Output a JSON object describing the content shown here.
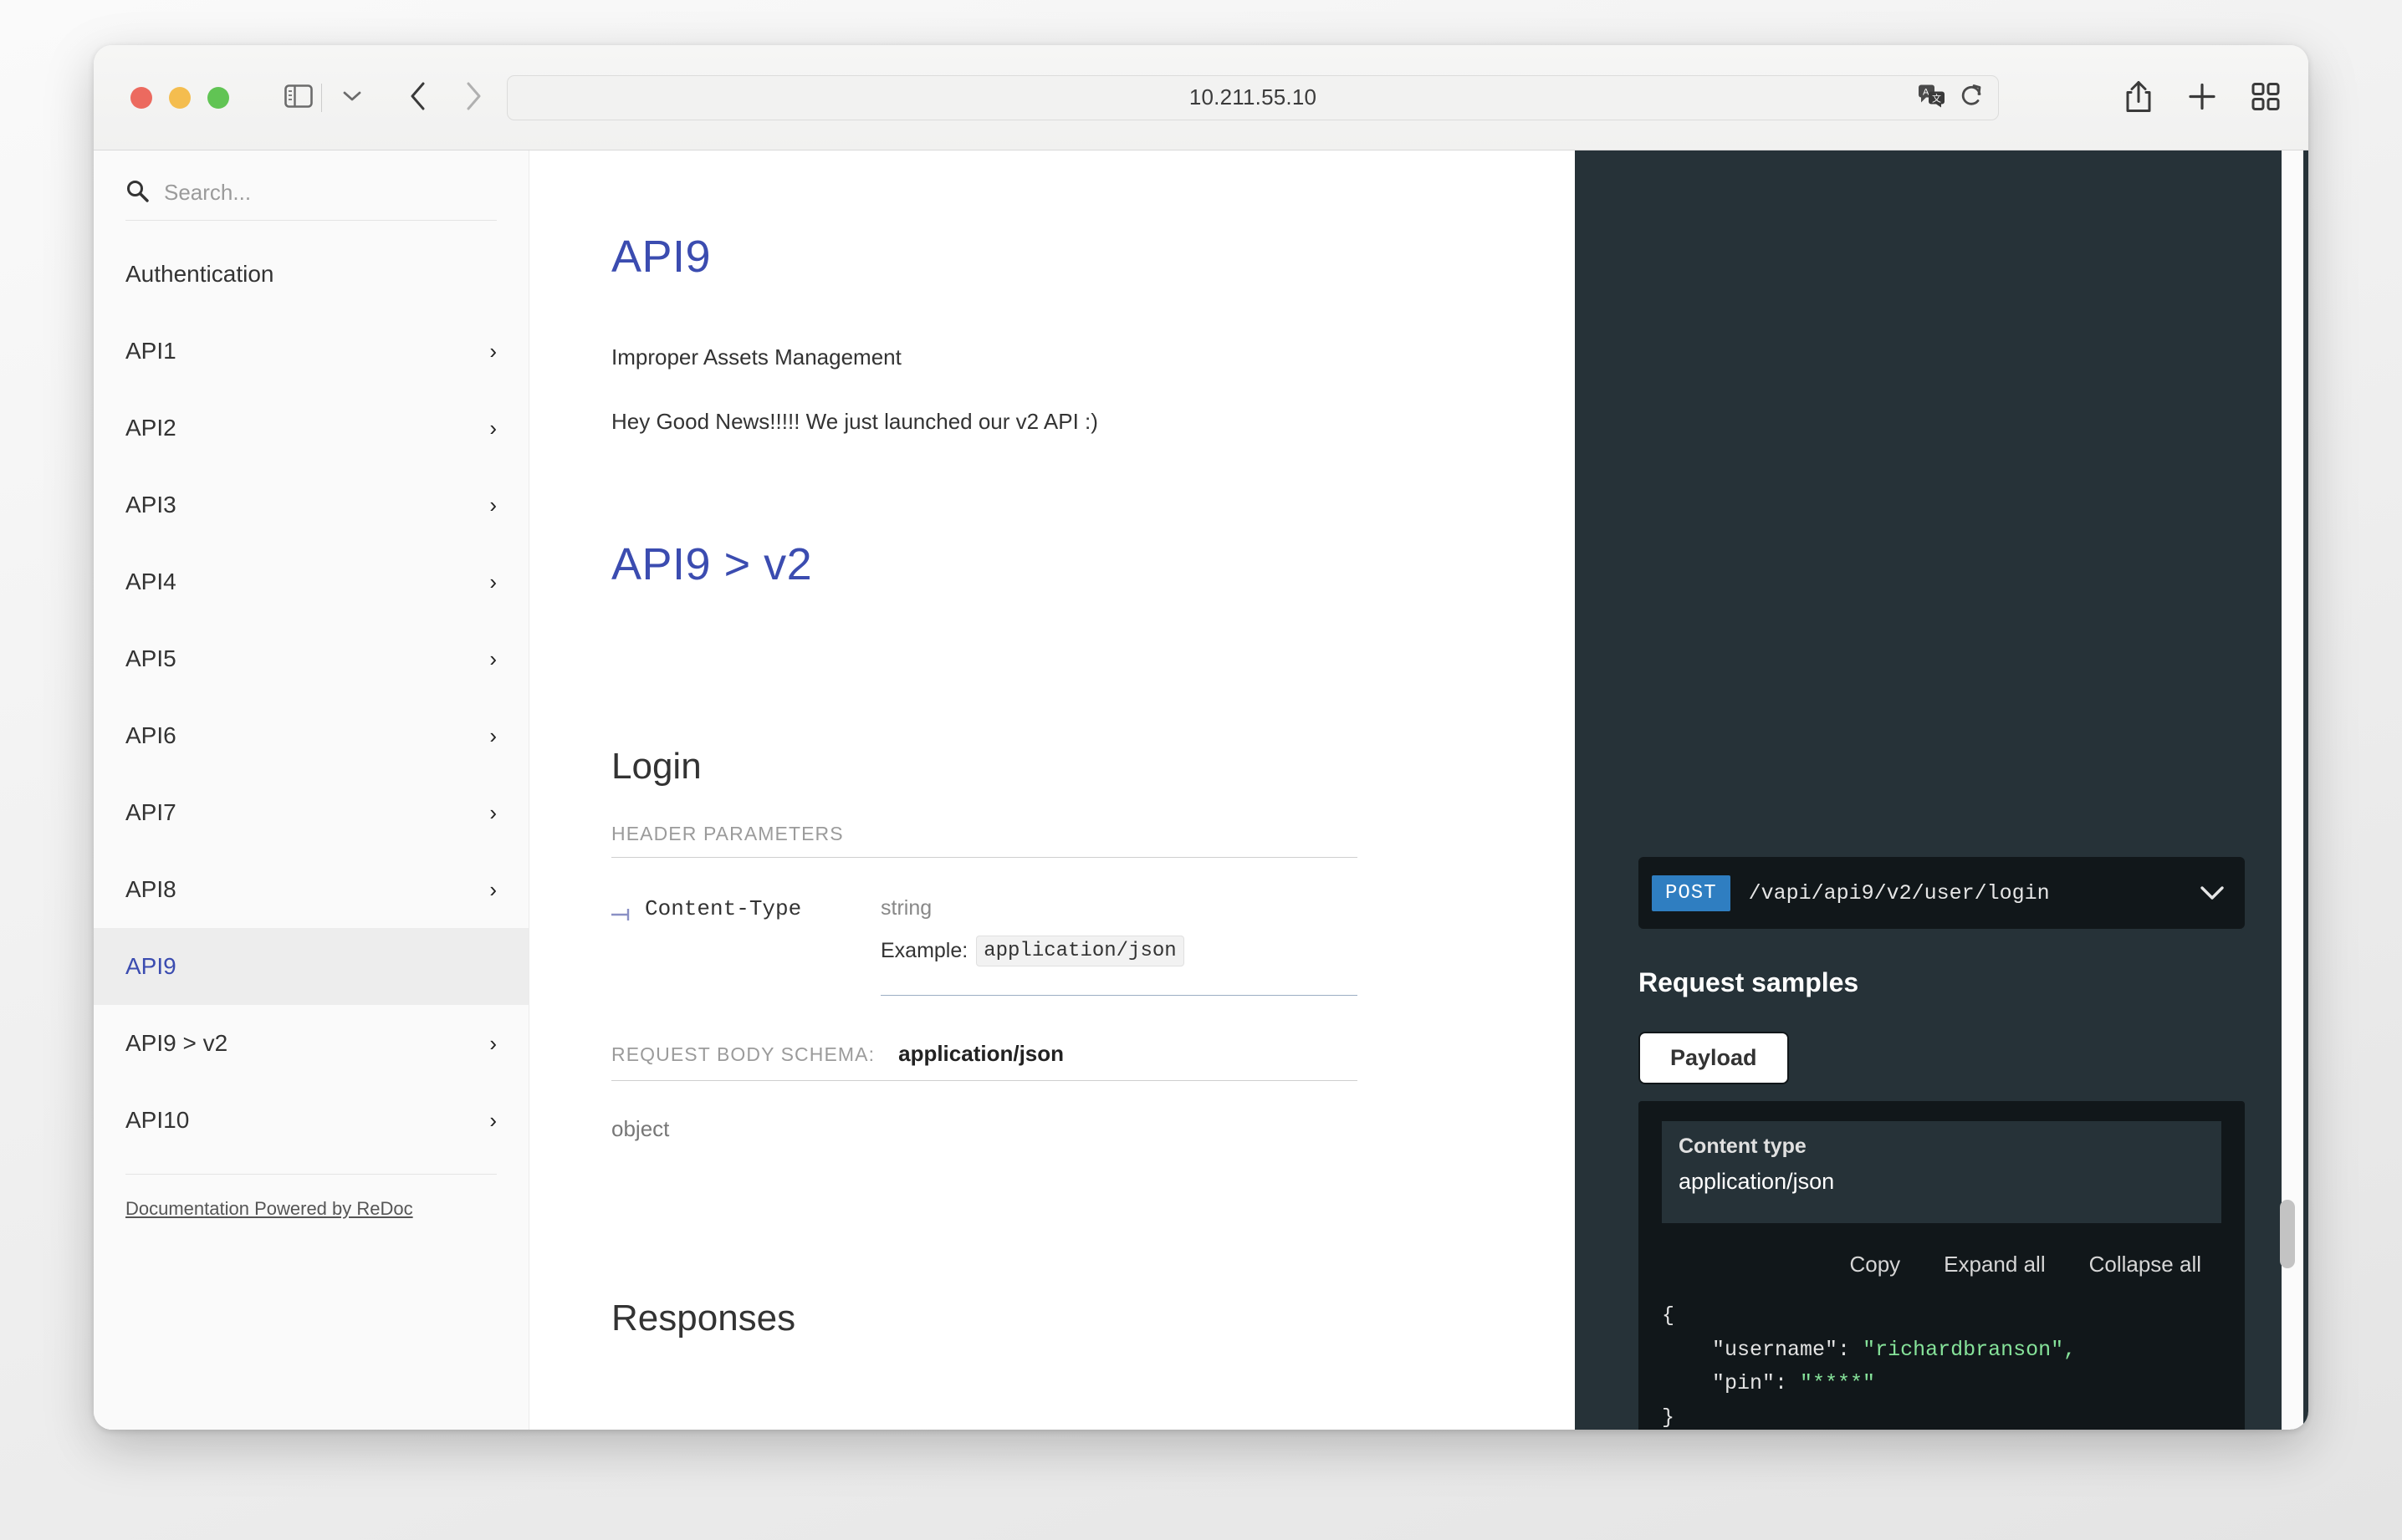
{
  "browser": {
    "window_controls": {
      "close": "close",
      "minimize": "minimize",
      "zoom": "zoom"
    },
    "sidebar_toggle_icon": "sidebar-icon",
    "sidebar_dropdown_icon": "chevron-down-icon",
    "back_icon": "chevron-left-icon",
    "forward_icon": "chevron-right-icon",
    "reload_page_icon": "refresh-circle-icon",
    "shield_icon": "privacy-shield-icon",
    "url": "10.211.55.10",
    "translate_icon": "translate-icon",
    "reload_icon": "reload-icon",
    "share_icon": "share-icon",
    "new_tab_icon": "plus-icon",
    "tab_overview_icon": "tab-grid-icon"
  },
  "sidebar": {
    "search": {
      "placeholder": "Search...",
      "value": "",
      "icon": "search-icon"
    },
    "items": [
      {
        "label": "Authentication",
        "expandable": false,
        "active": false
      },
      {
        "label": "API1",
        "expandable": true,
        "active": false
      },
      {
        "label": "API2",
        "expandable": true,
        "active": false
      },
      {
        "label": "API3",
        "expandable": true,
        "active": false
      },
      {
        "label": "API4",
        "expandable": true,
        "active": false
      },
      {
        "label": "API5",
        "expandable": true,
        "active": false
      },
      {
        "label": "API6",
        "expandable": true,
        "active": false
      },
      {
        "label": "API7",
        "expandable": true,
        "active": false
      },
      {
        "label": "API8",
        "expandable": true,
        "active": false
      },
      {
        "label": "API9",
        "expandable": false,
        "active": true
      },
      {
        "label": "API9 > v2",
        "expandable": true,
        "active": false
      },
      {
        "label": "API10",
        "expandable": true,
        "active": false
      }
    ],
    "chevron_glyph": "›",
    "footer_link": "Documentation Powered by ReDoc"
  },
  "main": {
    "title": "API9",
    "description": "Improper Assets Management",
    "news": "Hey Good News!!!!! We just launched our v2 API :)",
    "subtitle": "API9 > v2",
    "operation_title": "Login",
    "header_parameters_label": "HEADER PARAMETERS",
    "param": {
      "name": "Content-Type",
      "type": "string",
      "example_label": "Example:",
      "example_value": "application/json"
    },
    "request_body_schema_label": "REQUEST BODY SCHEMA:",
    "request_body_schema_value": "application/json",
    "body_object_type": "object",
    "responses_title": "Responses"
  },
  "right_panel": {
    "method": "POST",
    "path": "/vapi/api9/v2/user/login",
    "expand_icon": "chevron-down-icon",
    "request_samples_title": "Request samples",
    "payload_tab": "Payload",
    "content_type_label": "Content type",
    "content_type_value": "application/json",
    "actions": {
      "copy": "Copy",
      "expand_all": "Expand all",
      "collapse_all": "Collapse all"
    },
    "json": {
      "open_brace": "{",
      "line1_key": "\"username\":",
      "line1_val": "\"richardbranson\",",
      "line2_key": "\"pin\":",
      "line2_val": "\"****\"",
      "close_brace": "}"
    }
  },
  "colors": {
    "accent_blue": "#3b4cb0",
    "panel_dark": "#263238",
    "code_dark": "#11171a",
    "verb_blue": "#2f7ec1",
    "json_string_green": "#86e39a"
  }
}
